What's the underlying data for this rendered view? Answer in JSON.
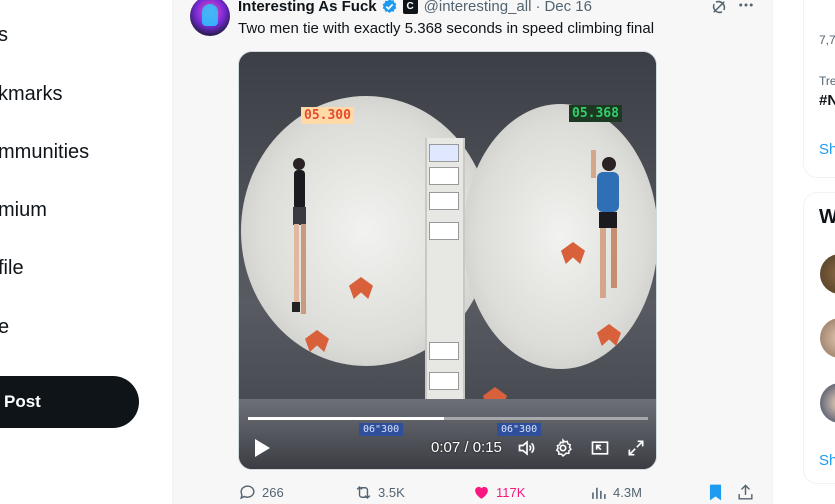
{
  "nav": {
    "items": [
      "s",
      "kmarks",
      "mmunities",
      "mium",
      "file",
      "e"
    ],
    "post_label": "Post"
  },
  "tweet": {
    "author_name": "Interesting As Fuck",
    "affiliate_badge": "C",
    "handle": "@interesting_all",
    "separator": "·",
    "date": "Dec 16",
    "text": "Two men tie with exactly 5.368 seconds in speed climbing final",
    "video": {
      "timer_left": "05.300",
      "timer_right": "05.368",
      "time_display": "0:07 / 0:15",
      "progress": 0.49,
      "scoreboard_left": "06\"300",
      "scoreboard_right": "06\"300"
    },
    "actions": {
      "replies": "266",
      "reposts": "3.5K",
      "likes": "117K",
      "views": "4.3M"
    }
  },
  "sidebar": {
    "count_top": "7,7",
    "trending_label": "Tre",
    "trending_tag": "#N",
    "show_more_1": "Sh",
    "who_to_follow": "W",
    "show_more_2": "Sh"
  },
  "colors": {
    "accent": "#1d9bf0",
    "like": "#f91880",
    "text": "#0f1419",
    "muted": "#536471"
  }
}
